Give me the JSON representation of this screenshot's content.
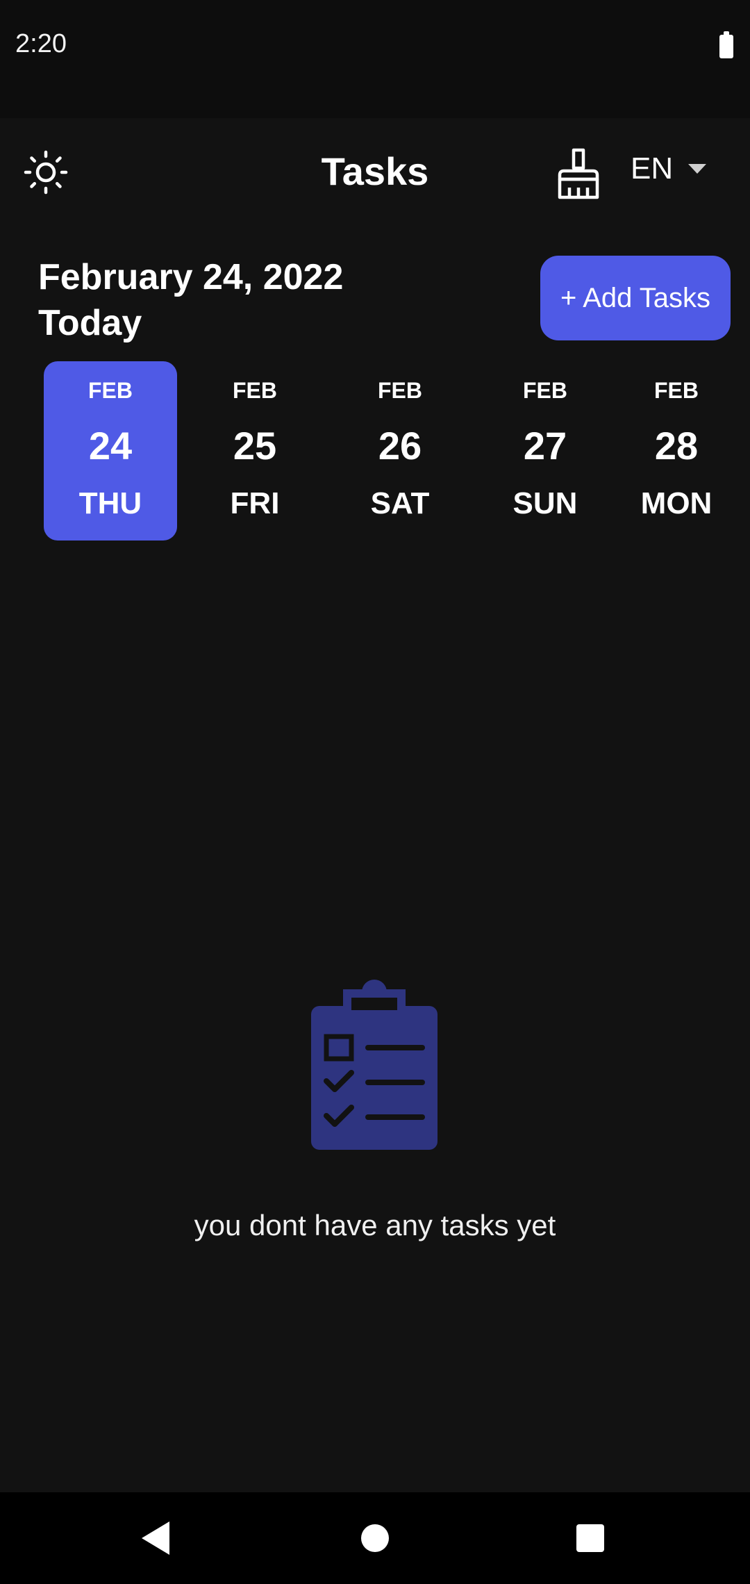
{
  "status_bar": {
    "time": "2:20",
    "battery_icon": "battery-full-icon"
  },
  "app_bar": {
    "title": "Tasks",
    "theme_icon": "sun-icon",
    "clean_icon": "broom-icon",
    "language": "EN",
    "language_caret_icon": "caret-down-icon"
  },
  "header": {
    "date": "February 24, 2022",
    "day_label": "Today",
    "add_button_label": "+ Add Tasks"
  },
  "days": [
    {
      "month": "FEB",
      "date": "24",
      "weekday": "THU",
      "selected": true
    },
    {
      "month": "FEB",
      "date": "25",
      "weekday": "FRI",
      "selected": false
    },
    {
      "month": "FEB",
      "date": "26",
      "weekday": "SAT",
      "selected": false
    },
    {
      "month": "FEB",
      "date": "27",
      "weekday": "SUN",
      "selected": false
    },
    {
      "month": "FEB",
      "date": "28",
      "weekday": "MON",
      "selected": false
    }
  ],
  "empty_state": {
    "icon": "clipboard-checklist-icon",
    "message": "you dont have any tasks yet"
  },
  "nav_bar": {
    "back_icon": "back-triangle-icon",
    "home_icon": "home-circle-icon",
    "recents_icon": "recents-square-icon"
  },
  "colors": {
    "background": "#121212",
    "accent": "#4f5ae6",
    "empty_icon": "#2e3480"
  }
}
